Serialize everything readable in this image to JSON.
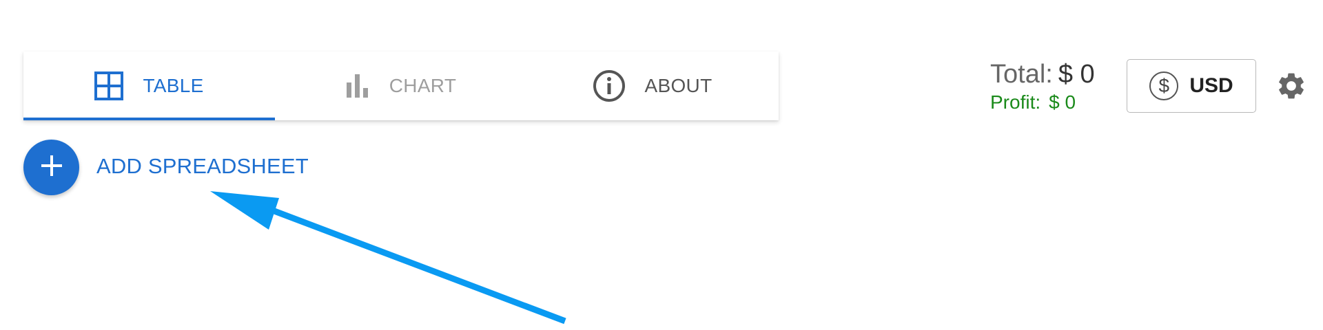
{
  "tabs": [
    {
      "label": "TABLE",
      "icon": "grid-icon",
      "active": true
    },
    {
      "label": "CHART",
      "icon": "bar-chart-icon",
      "active": false
    },
    {
      "label": "ABOUT",
      "icon": "info-icon",
      "active": false
    }
  ],
  "actions": {
    "add_spreadsheet_label": "ADD SPREADSHEET",
    "add_icon": "plus-icon"
  },
  "summary": {
    "total_label": "Total:",
    "total_value": "$ 0",
    "profit_label": "Profit:",
    "profit_value": "$ 0"
  },
  "currency": {
    "symbol": "$",
    "code": "USD"
  },
  "settings": {
    "icon": "gear-icon"
  },
  "annotation": {
    "icon": "pointer-arrow-icon",
    "color": "#0a9af2"
  },
  "colors": {
    "accent": "#1e6fd0",
    "profit": "#1a8a1a",
    "annotation_arrow": "#0a9af2"
  }
}
